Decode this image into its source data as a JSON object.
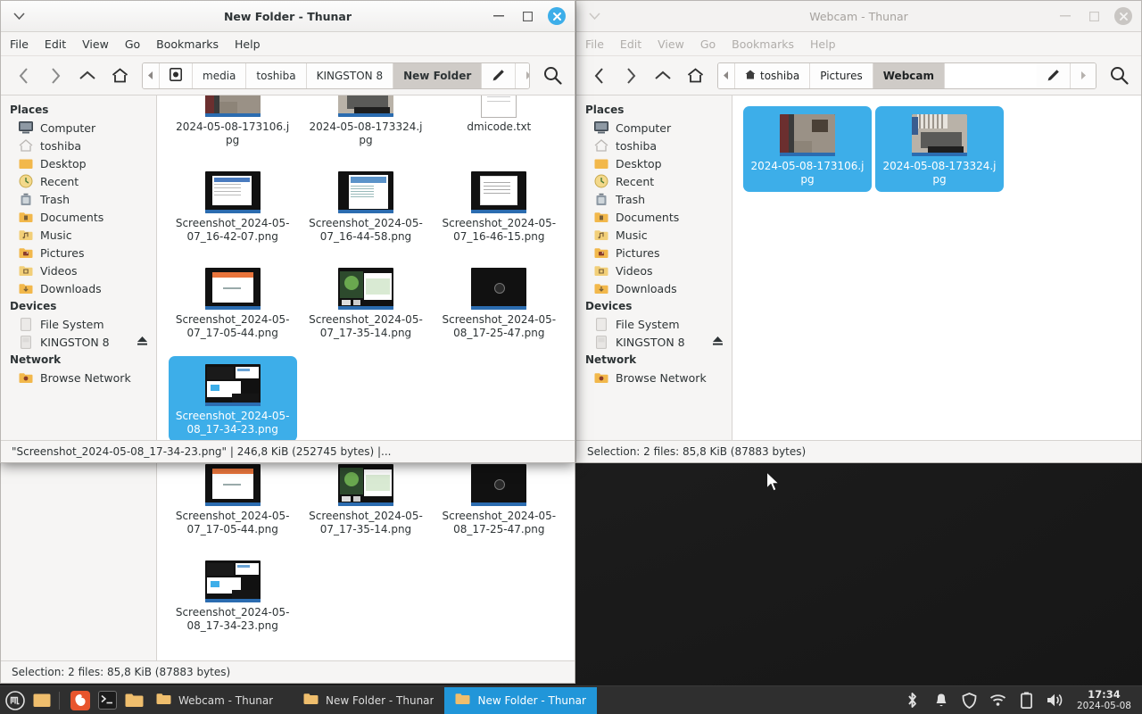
{
  "colors": {
    "accent": "#3daee9",
    "taskbar_bg": "#2f2f2f",
    "taskbar_active": "#2196d9",
    "window_bg": "#f6f5f4",
    "selection": "#3daee9"
  },
  "desktop": {
    "name": "xfce-desktop"
  },
  "windows": {
    "back": {
      "title": "New Folder - Thunar",
      "sidebar": {
        "sections": [
          {
            "head": "Places",
            "items": [
              {
                "label": "Computer",
                "icon": "computer-icon"
              },
              {
                "label": "toshiba",
                "icon": "home-icon"
              },
              {
                "label": "Desktop",
                "icon": "desktop-folder-icon"
              },
              {
                "label": "Recent",
                "icon": "recent-icon"
              },
              {
                "label": "Trash",
                "icon": "trash-icon"
              },
              {
                "label": "Documents",
                "icon": "documents-folder-icon"
              },
              {
                "label": "Music",
                "icon": "music-folder-icon"
              },
              {
                "label": "Pictures",
                "icon": "pictures-folder-icon"
              },
              {
                "label": "Videos",
                "icon": "videos-folder-icon"
              },
              {
                "label": "Downloads",
                "icon": "downloads-folder-icon"
              }
            ]
          },
          {
            "head": "Devices",
            "items": [
              {
                "label": "File System",
                "icon": "drive-icon"
              },
              {
                "label": "KINGSTON 8",
                "icon": "usb-drive-icon",
                "eject": true
              }
            ]
          },
          {
            "head": "Network",
            "items": [
              {
                "label": "Browse Network",
                "icon": "network-folder-icon"
              }
            ]
          }
        ]
      },
      "files_row1": [
        {
          "name": "Screenshot_2024-05-07_16-42-07.png"
        },
        {
          "name": "Screenshot_2024-05-07_16-44-58.png"
        },
        {
          "name": "Screenshot_2024-05-07_16-46-15.png"
        }
      ],
      "files_row2": [
        {
          "name": "Screenshot_2024-05-07_17-05-44.png"
        },
        {
          "name": "Screenshot_2024-05-07_17-35-14.png"
        },
        {
          "name": "Screenshot_2024-05-08_17-25-47.png"
        }
      ],
      "status": "Selection: 2 files: 85,8 KiB (87883 bytes)"
    },
    "new_folder": {
      "title": "New Folder - Thunar",
      "menu": [
        "File",
        "Edit",
        "View",
        "Go",
        "Bookmarks",
        "Help"
      ],
      "toolbar": {
        "back": "back-icon",
        "forward": "forward-icon",
        "up": "up-icon",
        "home": "home-icon",
        "search": "search-icon",
        "edit_path": "pencil-icon"
      },
      "breadcrumbs": [
        "media",
        "toshiba",
        "KINGSTON 8",
        "New Folder"
      ],
      "breadcrumb_current": "New Folder",
      "sidebar": {
        "sections": [
          {
            "head": "Places",
            "items": [
              {
                "label": "Computer",
                "icon": "computer-icon"
              },
              {
                "label": "toshiba",
                "icon": "home-icon"
              },
              {
                "label": "Desktop",
                "icon": "desktop-folder-icon"
              },
              {
                "label": "Recent",
                "icon": "recent-icon"
              },
              {
                "label": "Trash",
                "icon": "trash-icon"
              },
              {
                "label": "Documents",
                "icon": "documents-folder-icon"
              },
              {
                "label": "Music",
                "icon": "music-folder-icon"
              },
              {
                "label": "Pictures",
                "icon": "pictures-folder-icon"
              },
              {
                "label": "Videos",
                "icon": "videos-folder-icon"
              },
              {
                "label": "Downloads",
                "icon": "downloads-folder-icon"
              }
            ]
          },
          {
            "head": "Devices",
            "items": [
              {
                "label": "File System",
                "icon": "drive-icon"
              },
              {
                "label": "KINGSTON 8",
                "icon": "usb-drive-icon",
                "eject": true
              }
            ]
          },
          {
            "head": "Network",
            "items": [
              {
                "label": "Browse Network",
                "icon": "network-folder-icon"
              }
            ]
          }
        ]
      },
      "files_row0": [
        {
          "name": "2024-05-08-173106.jpg"
        },
        {
          "name": "2024-05-08-173324.jpg"
        },
        {
          "name": "dmicode.txt"
        }
      ],
      "files_row1": [
        {
          "name": "Screenshot_2024-05-07_16-42-07.png"
        },
        {
          "name": "Screenshot_2024-05-07_16-44-58.png"
        },
        {
          "name": "Screenshot_2024-05-07_16-46-15.png"
        }
      ],
      "files_row2": [
        {
          "name": "Screenshot_2024-05-07_17-05-44.png"
        },
        {
          "name": "Screenshot_2024-05-07_17-35-14.png"
        },
        {
          "name": "Screenshot_2024-05-08_17-25-47.png"
        }
      ],
      "selected_file": {
        "name": "Screenshot_2024-05-08_17-34-23.png"
      },
      "status": "\"Screenshot_2024-05-08_17-34-23.png\" | 246,8 KiB (252745 bytes) |..."
    },
    "webcam": {
      "title": "Webcam - Thunar",
      "menu": [
        "File",
        "Edit",
        "View",
        "Go",
        "Bookmarks",
        "Help"
      ],
      "breadcrumbs": [
        "toshiba",
        "Pictures",
        "Webcam"
      ],
      "breadcrumb_current": "Webcam",
      "sidebar": {
        "sections": [
          {
            "head": "Places",
            "items": [
              {
                "label": "Computer",
                "icon": "computer-icon"
              },
              {
                "label": "toshiba",
                "icon": "home-icon"
              },
              {
                "label": "Desktop",
                "icon": "desktop-folder-icon"
              },
              {
                "label": "Recent",
                "icon": "recent-icon"
              },
              {
                "label": "Trash",
                "icon": "trash-icon"
              },
              {
                "label": "Documents",
                "icon": "documents-folder-icon"
              },
              {
                "label": "Music",
                "icon": "music-folder-icon"
              },
              {
                "label": "Pictures",
                "icon": "pictures-folder-icon"
              },
              {
                "label": "Videos",
                "icon": "videos-folder-icon"
              },
              {
                "label": "Downloads",
                "icon": "downloads-folder-icon"
              }
            ]
          },
          {
            "head": "Devices",
            "items": [
              {
                "label": "File System",
                "icon": "drive-icon"
              },
              {
                "label": "KINGSTON 8",
                "icon": "usb-drive-icon",
                "eject": true
              }
            ]
          },
          {
            "head": "Network",
            "items": [
              {
                "label": "Browse Network",
                "icon": "network-folder-icon"
              }
            ]
          }
        ]
      },
      "files": [
        {
          "name": "2024-05-08-173106.jpg",
          "selected": true
        },
        {
          "name": "2024-05-08-173324.jpg",
          "selected": true
        }
      ],
      "status": "Selection: 2 files: 85,8 KiB (87883 bytes)"
    }
  },
  "taskbar": {
    "launchers": [
      "menu-icon",
      "files-icon",
      "firefox-icon",
      "terminal-icon",
      "folder-icon"
    ],
    "buttons": [
      {
        "label": "Webcam - Thunar",
        "active": false,
        "icon": "folder-icon"
      },
      {
        "label": "New Folder - Thunar",
        "active": false,
        "icon": "folder-icon"
      },
      {
        "label": "New Folder - Thunar",
        "active": true,
        "icon": "folder-icon"
      }
    ],
    "tray": [
      "bluetooth-icon",
      "notification-bell-icon",
      "shield-icon",
      "wifi-icon",
      "battery-icon",
      "volume-icon"
    ],
    "clock": {
      "time": "17:34",
      "date": "2024-05-08"
    }
  }
}
